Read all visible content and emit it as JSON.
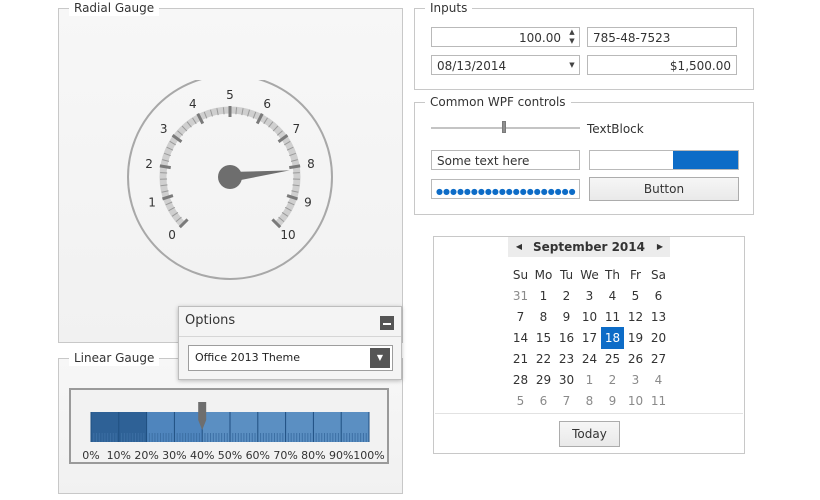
{
  "radial_gauge": {
    "title": "Radial Gauge",
    "ticks": [
      "0",
      "1",
      "2",
      "3",
      "4",
      "5",
      "6",
      "7",
      "8",
      "9",
      "10"
    ],
    "value": 8.1
  },
  "linear_gauge": {
    "title": "Linear Gauge",
    "labels": [
      "0%",
      "10%",
      "20%",
      "30%",
      "40%",
      "50%",
      "60%",
      "70%",
      "80%",
      "90%",
      "100%"
    ],
    "value_percent": 40
  },
  "inputs": {
    "title": "Inputs",
    "numeric_value": "100.00",
    "masked_value": "785-48-7523",
    "date_value": "08/13/2014",
    "currency_value": "$1,500.00"
  },
  "common": {
    "title": "Common WPF controls",
    "textblock": "TextBlock",
    "textbox_value": "Some text here",
    "password_dots": "●●●●●●●●●●●●●●●●●●●●",
    "button_label": "Button",
    "slider_value": 0.49,
    "progress_value": 0.44
  },
  "calendar": {
    "month_title": "September 2014",
    "weekdays": [
      "Su",
      "Mo",
      "Tu",
      "We",
      "Th",
      "Fr",
      "Sa"
    ],
    "weeks": [
      [
        "31",
        "1",
        "2",
        "3",
        "4",
        "5",
        "6"
      ],
      [
        "7",
        "8",
        "9",
        "10",
        "11",
        "12",
        "13"
      ],
      [
        "14",
        "15",
        "16",
        "17",
        "18",
        "19",
        "20"
      ],
      [
        "21",
        "22",
        "23",
        "24",
        "25",
        "26",
        "27"
      ],
      [
        "28",
        "29",
        "30",
        "1",
        "2",
        "3",
        "4"
      ],
      [
        "5",
        "6",
        "7",
        "8",
        "9",
        "10",
        "11"
      ]
    ],
    "selected_day": "18",
    "today_label": "Today"
  },
  "options": {
    "title": "Options",
    "theme_value": "Office 2013 Theme"
  },
  "colors": {
    "accent": "#0d6cc7",
    "gauge_gray": "#6e6e6e",
    "linear_dark": "#2e6196",
    "linear_light": "#5b8fc2"
  }
}
